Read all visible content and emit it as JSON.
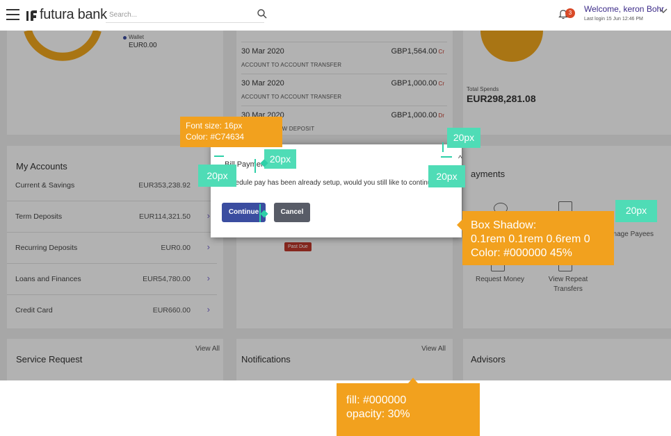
{
  "header": {
    "brand": "futura bank",
    "search_placeholder": "Search...",
    "notification_count": "3",
    "welcome": "Welcome, keron Bohr",
    "last_login": "Last login 15 Jun 12:46 PM"
  },
  "summary_card": {
    "legend_label": "Wallet",
    "legend_value": "EUR0.00"
  },
  "transactions": [
    {
      "date": "30 Mar 2020",
      "desc": "ACCOUNT TO ACCOUNT TRANSFER",
      "amount": "GBP1,564.00",
      "type": "Cr"
    },
    {
      "date": "30 Mar 2020",
      "desc": "ACCOUNT TO ACCOUNT TRANSFER",
      "amount": "GBP1,000.00",
      "type": "Cr"
    },
    {
      "date": "30 Mar 2020",
      "desc": "0 NEW DEPOSIT",
      "amount": "GBP1,000.00",
      "type": "Dr"
    }
  ],
  "spends": {
    "label": "Total Spends",
    "amount": "EUR298,281.08"
  },
  "my_accounts": {
    "title": "My Accounts",
    "rows": [
      {
        "name": "Current & Savings",
        "amount": "EUR353,238.92"
      },
      {
        "name": "Term Deposits",
        "amount": "EUR114,321.50"
      },
      {
        "name": "Recurring Deposits",
        "amount": "EUR0.00"
      },
      {
        "name": "Loans and Finances",
        "amount": "EUR54,780.00"
      },
      {
        "name": "Credit Card",
        "amount": "EUR660.00"
      }
    ]
  },
  "middle_card": {
    "badge": "Past Due"
  },
  "payments": {
    "title": "ayments",
    "manage_payees": "anage Payees",
    "request_money": "Request Money",
    "view_repeat": "View Repeat",
    "transfers": "Transfers"
  },
  "service_request": {
    "title": "Service Request",
    "view_all": "View All"
  },
  "notifications": {
    "title": "Notifications",
    "view_all": "View All"
  },
  "advisors": {
    "title": "Advisors"
  },
  "dialog": {
    "title": "Bill Payment",
    "message": "schedule pay has been already setup, would you still like to continue?",
    "continue_label": "Continue",
    "cancel_label": "Cancel"
  },
  "annotations": {
    "font_line1": "Font size: 16px",
    "font_line2": "Color: #C74634",
    "shadow_line1": "Box Shadow:",
    "shadow_line2": "0.1rem 0.1rem 0.6rem 0",
    "shadow_line3": "Color: #000000 45%",
    "fill_line1": "fill: #000000",
    "fill_line2": "opacity: 30%",
    "spacing_tags": [
      "20px",
      "20px",
      "20px",
      "20px",
      "20px"
    ]
  },
  "colors": {
    "overlay": "#000000",
    "title": "#C74634",
    "note_bg": "#f2a11e",
    "tag_bg": "#4fdcb6",
    "primary_button": "#3b4da0"
  }
}
